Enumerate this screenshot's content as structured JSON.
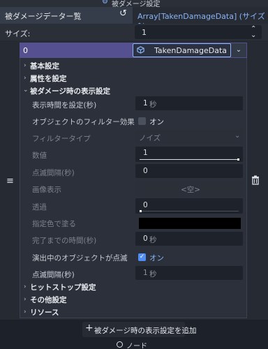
{
  "window": {
    "title": "被ダメージ設定",
    "icon": "gear-icon"
  },
  "property": {
    "name": "被ダメージデーター覧",
    "value": "Array[TakenDamageData] (サイズ 1)"
  },
  "size": {
    "label": "サイズ:",
    "value": "1"
  },
  "element": {
    "index": "0",
    "resource_type": "TakenDamageData"
  },
  "sections": {
    "basic": "基本設定",
    "attributes": "属性を設定",
    "display": "被ダメージ時の表示設定",
    "hitstop": "ヒットストップ設定",
    "others": "その他設定",
    "resources": "リソース"
  },
  "rows": {
    "display_time": {
      "label": "表示時間を設定(秒)",
      "value": "1",
      "unit": "秒"
    },
    "filter_effect": {
      "label": "オブジェクトのフィルター効果",
      "value": "オン",
      "checked": false
    },
    "filter_type": {
      "label": "フィルタータイプ",
      "value": "ノイズ"
    },
    "numeric": {
      "label": "数値",
      "value": "1",
      "fill_fraction": 1.0
    },
    "blink_interval": {
      "label": "点滅間隔(秒)",
      "value": "0"
    },
    "image": {
      "label": "画像表示",
      "value": "<空>"
    },
    "transparency": {
      "label": "透過",
      "value": "0",
      "fill_fraction": 0.0
    },
    "fill_color": {
      "label": "指定色で塗る",
      "color": "#000000"
    },
    "complete_time": {
      "label": "完了までの時間(秒)",
      "value": "0",
      "unit": "秒"
    },
    "blink_during": {
      "label": "演出中のオブジェクトが点滅",
      "value": "オン",
      "checked": true
    },
    "blink_interval2": {
      "label": "点滅間隔(秒)",
      "value": "1",
      "unit": "秒"
    }
  },
  "add_button": {
    "label": "被ダメージ時の表示設定を追加"
  },
  "bottom_tab": {
    "label": "ノード"
  },
  "colors": {
    "accent": "#8ab4f8",
    "index_row": "#55508f",
    "checkbox_on": "#4f8ef7"
  }
}
